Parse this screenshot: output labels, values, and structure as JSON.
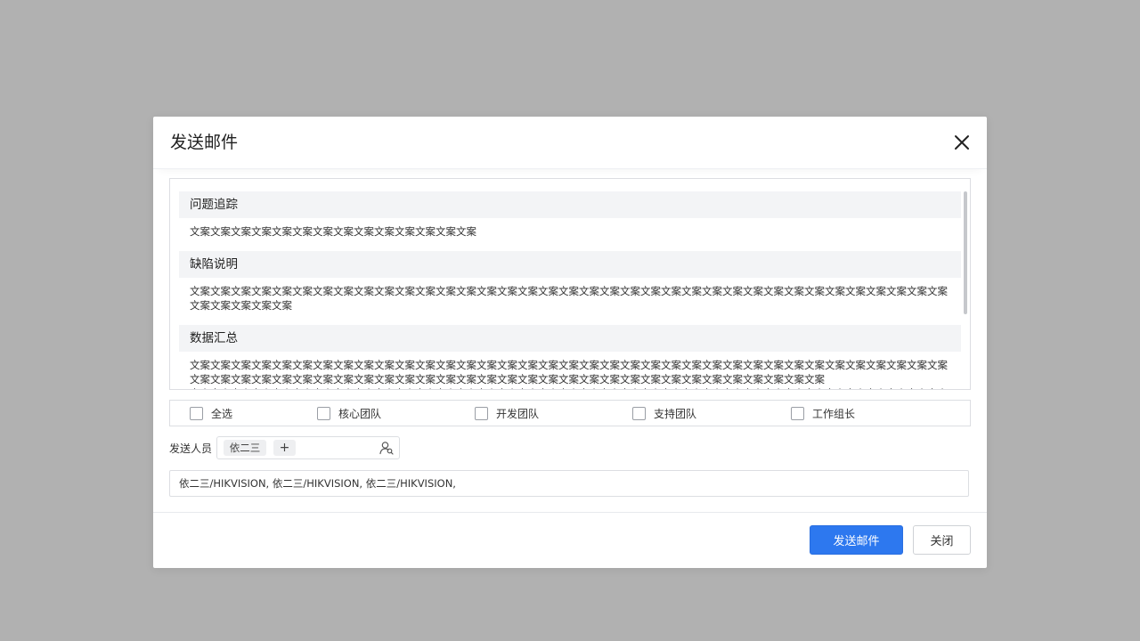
{
  "dialog": {
    "title": "发送邮件",
    "close_icon": "close-icon"
  },
  "content": {
    "sections": [
      {
        "title": "问题追踪",
        "body": "文案文案文案文案文案文案文案文案文案文案文案文案文案文案"
      },
      {
        "title": "缺陷说明",
        "body": "文案文案文案文案文案文案文案文案文案文案文案文案文案文案文案文案文案文案文案文案文案文案文案文案文案文案文案文案文案文案文案文案文案文案文案文案文案文案文案文案文案文案"
      },
      {
        "title": "数据汇总",
        "body": "文案文案文案文案文案文案文案文案文案文案文案文案文案文案文案文案文案文案文案文案文案文案文案文案文案文案文案文案文案文案文案文案文案文案文案文案文案文案文案文案文案文案文案文案文案文案文案文案文案文案文案文案文案文案文案文案文案文案文案文案文案文案文案文案文案文案文案文案\n文案文案文案文案文案文案文案文案文案文案文案文案文案文案文案文案文案文案文案文案文案文案文案文案文案文案文案文案文案文案文案文案文案文案文案文案文案文案文案文案文案文案文案文案文案文案文案文案文案文案文案文案文案文案文案文案"
      }
    ]
  },
  "checkboxes": [
    {
      "label": "全选",
      "checked": false
    },
    {
      "label": "核心团队",
      "checked": false
    },
    {
      "label": "开发团队",
      "checked": false
    },
    {
      "label": "支持团队",
      "checked": false
    },
    {
      "label": "工作组长",
      "checked": false
    }
  ],
  "sender": {
    "label": "发送人员",
    "tags": [
      "依二三"
    ],
    "add_label": "+",
    "picker_icon": "person-icon"
  },
  "recipients": {
    "value": "依二三/HIKVISION, 依二三/HIKVISION, 依二三/HIKVISION,"
  },
  "footer": {
    "send_label": "发送邮件",
    "close_label": "关闭",
    "primary_color": "#2d78ef"
  }
}
